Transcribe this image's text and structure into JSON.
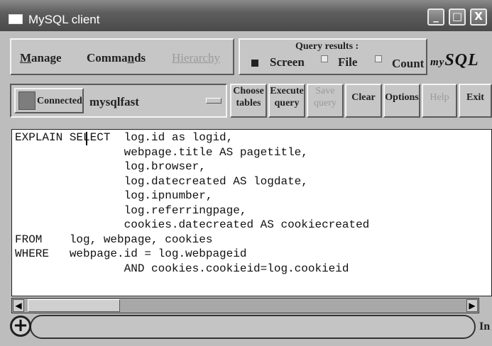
{
  "window": {
    "title": "MySQL client",
    "controls": [
      "_",
      "□",
      "X"
    ]
  },
  "menu": {
    "manage": "Manage",
    "commands": "Commands",
    "hierarchy": "Hierarchy"
  },
  "query_results": {
    "title": "Query results :",
    "options": [
      {
        "label": "Screen",
        "selected": true
      },
      {
        "label": "File",
        "selected": false
      },
      {
        "label": "Count",
        "selected": false
      }
    ]
  },
  "logo": {
    "prefix": "my",
    "main": "SQL"
  },
  "toolbar": {
    "connect": "Connected",
    "database": "mysqlfast",
    "choose_tables": [
      "Choose",
      "tables"
    ],
    "execute_query": [
      "Execute",
      "query"
    ],
    "save_query": [
      "Save",
      "query"
    ],
    "clear": "Clear",
    "options": "Options",
    "help": "Help",
    "exit": "Exit"
  },
  "editor": {
    "query": "EXPLAIN SELECT  log.id as logid,\n                webpage.title AS pagetitle,\n                log.browser,\n                log.datecreated AS logdate,\n                log.ipnumber,\n                log.referringpage,\n                cookies.datecreated AS cookiecreated\nFROM    log, webpage, cookies\nWHERE   webpage.id = log.webpageid\n                AND cookies.cookieid=log.cookieid"
  },
  "scrollbar": {
    "left": "◀",
    "right": "▶"
  },
  "status": {
    "plus": "+",
    "right_text": "In"
  },
  "colors": {
    "titlebar": "#5e5e5e",
    "panel": "#bdbdbd",
    "editor_bg": "#ffffff"
  }
}
